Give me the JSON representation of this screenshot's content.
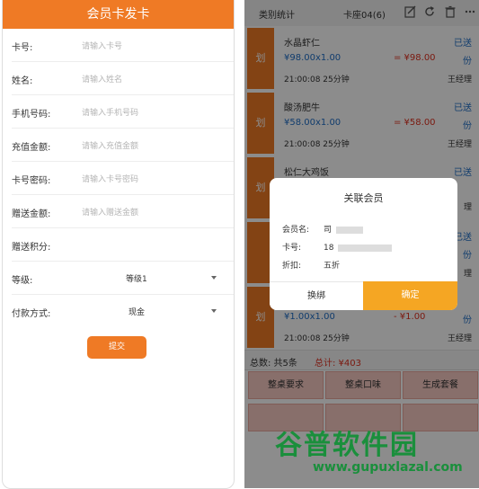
{
  "form": {
    "title": "会员卡发卡",
    "fields": [
      {
        "label": "卡号:",
        "placeholder": "请输入卡号"
      },
      {
        "label": "姓名:",
        "placeholder": "请输入姓名"
      },
      {
        "label": "手机号码:",
        "placeholder": "请输入手机号码"
      },
      {
        "label": "充值金额:",
        "placeholder": "请输入充值金额"
      },
      {
        "label": "卡号密码:",
        "placeholder": "请输入卡号密码"
      },
      {
        "label": "赠送金额:",
        "placeholder": "请输入赠送金额"
      },
      {
        "label": "赠送积分:",
        "placeholder": ""
      }
    ],
    "level": {
      "label": "等级:",
      "value": "等级1"
    },
    "payment": {
      "label": "付款方式:",
      "value": "现金"
    },
    "submit_label": "提交"
  },
  "orders_screen": {
    "tabs": [
      "类别统计",
      "卡座04(6)"
    ],
    "orders": [
      {
        "side": "划",
        "name": "水晶虾仁",
        "status": "已送",
        "qty": "¥98.00x1.00",
        "amount": "= ¥98.00",
        "unit": "份",
        "time": "21:00:08  25分钟",
        "manager": "王经理"
      },
      {
        "side": "划",
        "name": "酸汤肥牛",
        "status": "已送",
        "qty": "¥58.00x1.00",
        "amount": "= ¥58.00",
        "unit": "份",
        "time": "21:00:08  25分钟",
        "manager": "王经理"
      },
      {
        "side": "划",
        "name": "松仁大鸡饭",
        "status": "已送",
        "qty": "",
        "amount": "",
        "unit": "",
        "time": "",
        "manager": "理"
      },
      {
        "side": "",
        "name": "",
        "status": "已送",
        "qty": "",
        "amount": "",
        "unit": "份",
        "time": "",
        "manager": "理"
      },
      {
        "side": "划",
        "name": "",
        "status": "",
        "qty": "¥1.00x1.00",
        "amount": "- ¥1.00",
        "unit": "份",
        "time": "21:00:08  25分钟",
        "manager": "王经理"
      }
    ],
    "summary": {
      "count": "总数: 共5条",
      "total": "总计: ¥403"
    },
    "buttons": [
      "整桌要求",
      "整桌口味",
      "生成套餐"
    ],
    "colors": {
      "accent": "#ef7a25",
      "link": "#1f6ec7",
      "price": "#e0311f"
    }
  },
  "dialog": {
    "title": "关联会员",
    "name_label": "会员名:",
    "name_value": "司",
    "card_label": "卡号:",
    "card_value": "18",
    "discount_label": "折扣:",
    "discount_value": "五折",
    "cancel_label": "换绑",
    "confirm_label": "确定"
  },
  "watermark": {
    "text": "谷普软件园",
    "url": "www.gupuxlazal.com"
  }
}
